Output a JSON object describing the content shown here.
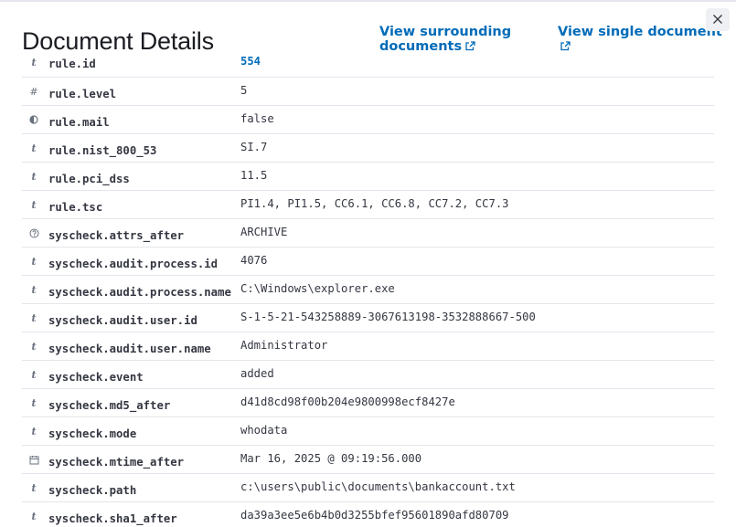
{
  "title": "Document Details",
  "links": {
    "surrounding": "View surrounding documents",
    "single": "View single document"
  },
  "colors": {
    "link": "#006bb8",
    "text": "#343741",
    "divider": "#e3e6ec"
  },
  "rows": [
    {
      "name": "rule.id",
      "value": "554",
      "type": "string-icon"
    },
    {
      "name": "rule.level",
      "value": "5",
      "type": "number-icon"
    },
    {
      "name": "rule.mail",
      "value": "false",
      "type": "boolean-icon"
    },
    {
      "name": "rule.nist_800_53",
      "value": "SI.7",
      "type": "string-icon"
    },
    {
      "name": "rule.pci_dss",
      "value": "11.5",
      "type": "string-icon"
    },
    {
      "name": "rule.tsc",
      "value": "PI1.4, PI1.5, CC6.1, CC6.8, CC7.2, CC7.3",
      "type": "string-icon"
    },
    {
      "name": "syscheck.attrs_after",
      "value": "ARCHIVE",
      "type": "unknown-icon"
    },
    {
      "name": "syscheck.audit.process.id",
      "value": "4076",
      "type": "string-icon"
    },
    {
      "name": "syscheck.audit.process.name",
      "value": "C:\\Windows\\explorer.exe",
      "type": "string-icon"
    },
    {
      "name": "syscheck.audit.user.id",
      "value": "S-1-5-21-543258889-3067613198-3532888667-500",
      "type": "string-icon"
    },
    {
      "name": "syscheck.audit.user.name",
      "value": "Administrator",
      "type": "string-icon"
    },
    {
      "name": "syscheck.event",
      "value": "added",
      "type": "string-icon"
    },
    {
      "name": "syscheck.md5_after",
      "value": "d41d8cd98f00b204e9800998ecf8427e",
      "type": "string-icon"
    },
    {
      "name": "syscheck.mode",
      "value": "whodata",
      "type": "string-icon"
    },
    {
      "name": "syscheck.mtime_after",
      "value": "Mar 16, 2025 @ 09:19:56.000",
      "type": "date-icon"
    },
    {
      "name": "syscheck.path",
      "value": "c:\\users\\public\\documents\\bankaccount.txt",
      "type": "string-icon"
    },
    {
      "name": "syscheck.sha1_after",
      "value": "da39a3ee5e6b4b0d3255bfef95601890afd80709",
      "type": "string-icon"
    }
  ]
}
